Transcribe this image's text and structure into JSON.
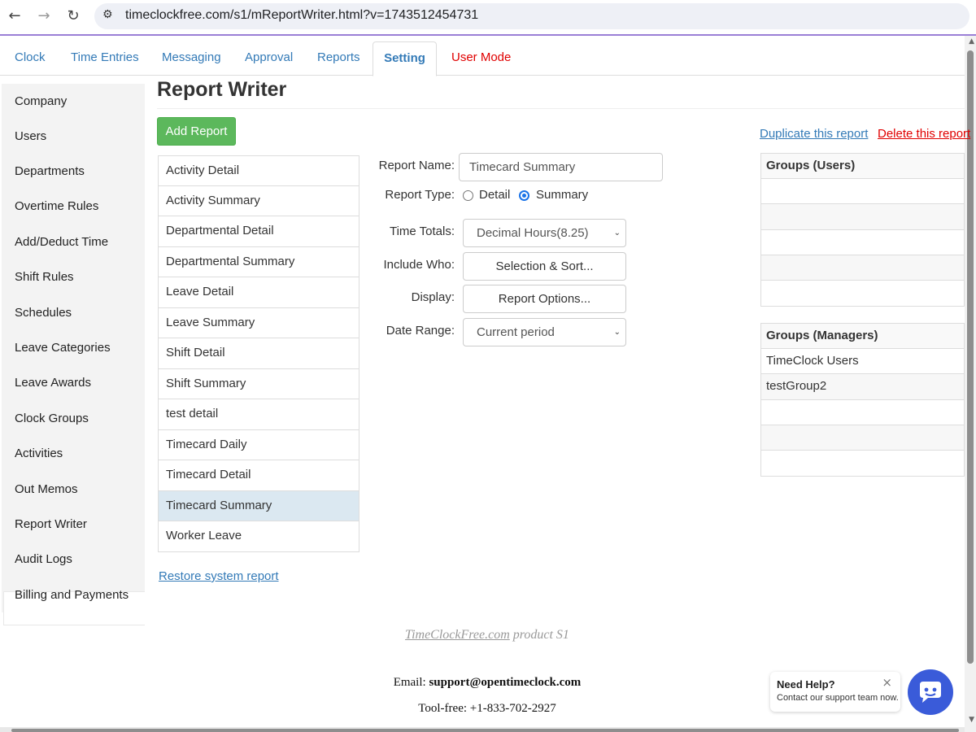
{
  "browser": {
    "url": "timeclockfree.com/s1/mReportWriter.html?v=1743512454731"
  },
  "tabs": [
    {
      "label": "Clock"
    },
    {
      "label": "Time Entries"
    },
    {
      "label": "Messaging"
    },
    {
      "label": "Approval"
    },
    {
      "label": "Reports"
    },
    {
      "label": "Setting"
    },
    {
      "label": "User Mode"
    }
  ],
  "sidebar": {
    "items": [
      {
        "label": "Company"
      },
      {
        "label": "Users"
      },
      {
        "label": "Departments"
      },
      {
        "label": "Overtime Rules"
      },
      {
        "label": "Add/Deduct Time"
      },
      {
        "label": "Shift Rules"
      },
      {
        "label": "Schedules"
      },
      {
        "label": "Leave Categories"
      },
      {
        "label": "Leave Awards"
      },
      {
        "label": "Clock Groups"
      },
      {
        "label": "Activities"
      },
      {
        "label": "Out Memos"
      },
      {
        "label": "Report Writer"
      },
      {
        "label": "Audit Logs"
      },
      {
        "label": "Billing and Payments"
      }
    ],
    "active": "Report Writer"
  },
  "main": {
    "title": "Report Writer",
    "add_report_label": "Add Report",
    "duplicate_label": "Duplicate this report",
    "delete_label": "Delete this report",
    "restore_label": "Restore system report",
    "reports": [
      "Activity Detail",
      "Activity Summary",
      "Departmental Detail",
      "Departmental Summary",
      "Leave Detail",
      "Leave Summary",
      "Shift Detail",
      "Shift Summary",
      "test detail",
      "Timecard Daily",
      "Timecard Detail",
      "Timecard Summary",
      "Worker Leave"
    ],
    "selected_report": "Timecard Summary"
  },
  "form": {
    "report_name_label": "Report Name:",
    "report_name_value": "Timecard Summary",
    "report_type_label": "Report Type:",
    "type_detail_label": "Detail",
    "type_summary_label": "Summary",
    "report_type_selected": "Summary",
    "time_totals_label": "Time Totals:",
    "time_totals_value": "Decimal Hours(8.25)",
    "include_who_label": "Include Who:",
    "include_who_button": "Selection & Sort...",
    "display_label": "Display:",
    "display_button": "Report Options...",
    "date_range_label": "Date Range:",
    "date_range_value": "Current period"
  },
  "groups_users": {
    "header": "Groups (Users)",
    "rows": [
      "",
      "",
      "",
      "",
      ""
    ]
  },
  "groups_managers": {
    "header": "Groups (Managers)",
    "rows": [
      "TimeClock Users",
      "testGroup2",
      "",
      "",
      ""
    ]
  },
  "footer": {
    "product_link": "TimeClockFree.com",
    "product_suffix": " product S1",
    "email_label": "Email: ",
    "email_value": "support@opentimeclock.com",
    "phone_text": "Tool-free: +1-833-702-2927"
  },
  "help": {
    "title": "Need Help?",
    "subtitle": "Contact our support team now."
  },
  "colors": {
    "link_blue": "#337ab7",
    "danger_red": "#e00000",
    "success_green": "#5cb85c",
    "selected_row": "#dbe8f1",
    "chat_button": "#3a5bd9"
  }
}
